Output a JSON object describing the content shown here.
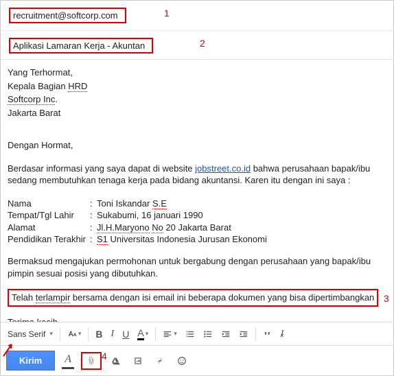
{
  "annotations": {
    "n1": "1",
    "n2": "2",
    "n3": "3",
    "n4": "4"
  },
  "to": "recruitment@softcorp.com",
  "subject": "Aplikasi Lamaran Kerja - Akuntan",
  "body": {
    "salutation": "Yang Terhormat,",
    "hrd_pre": "Kepala Bagian ",
    "hrd_ul": "HRD",
    "company": "Softcorp Inc",
    "company_dot": ".",
    "city": "Jakarta Barat",
    "greeting": "Dengan Hormat,",
    "intro_pre": "Berdasar informasi yang saya dapat di website ",
    "intro_link": "jobstreet.co.id",
    "intro_post": " bahwa perusahaan bapak/ibu sedang membutuhkan tenaga kerja pada bidang akuntansi. Karen itu dengan ini saya :",
    "rows": {
      "name_lbl": "Nama",
      "name_val_pre": "Toni Iskandar ",
      "name_val_ul": "S.E",
      "birth_lbl": "Tempat/Tgl Lahir",
      "birth_val": "Sukabumi, 16 januari 1990",
      "addr_lbl": "Alamat",
      "addr_val_ul1": "Jl.H.Maryono",
      "addr_val_mid": " ",
      "addr_val_ul2": "No",
      "addr_val_post": " 20 Jakarta Barat",
      "edu_lbl": "Pendidikan Terakhir",
      "edu_val_pre": "",
      "edu_val_ul": "S1",
      "edu_val_post": " Universitas Indonesia Jurusan Ekonomi"
    },
    "intent": "Bermaksud mengajukan permohonan untuk bergabung dengan perusahaan yang bapak/ibu pimpin sesuai posisi yang dibutuhkan.",
    "attach_pre": "Telah ",
    "attach_ul": "terlampir",
    "attach_post": " bersama dengan isi email ini beberapa dokumen yang bisa dipertimbangkan",
    "thanks": "Terima kasih."
  },
  "toolbar": {
    "font": "Sans Serif",
    "send": "Kirim"
  }
}
